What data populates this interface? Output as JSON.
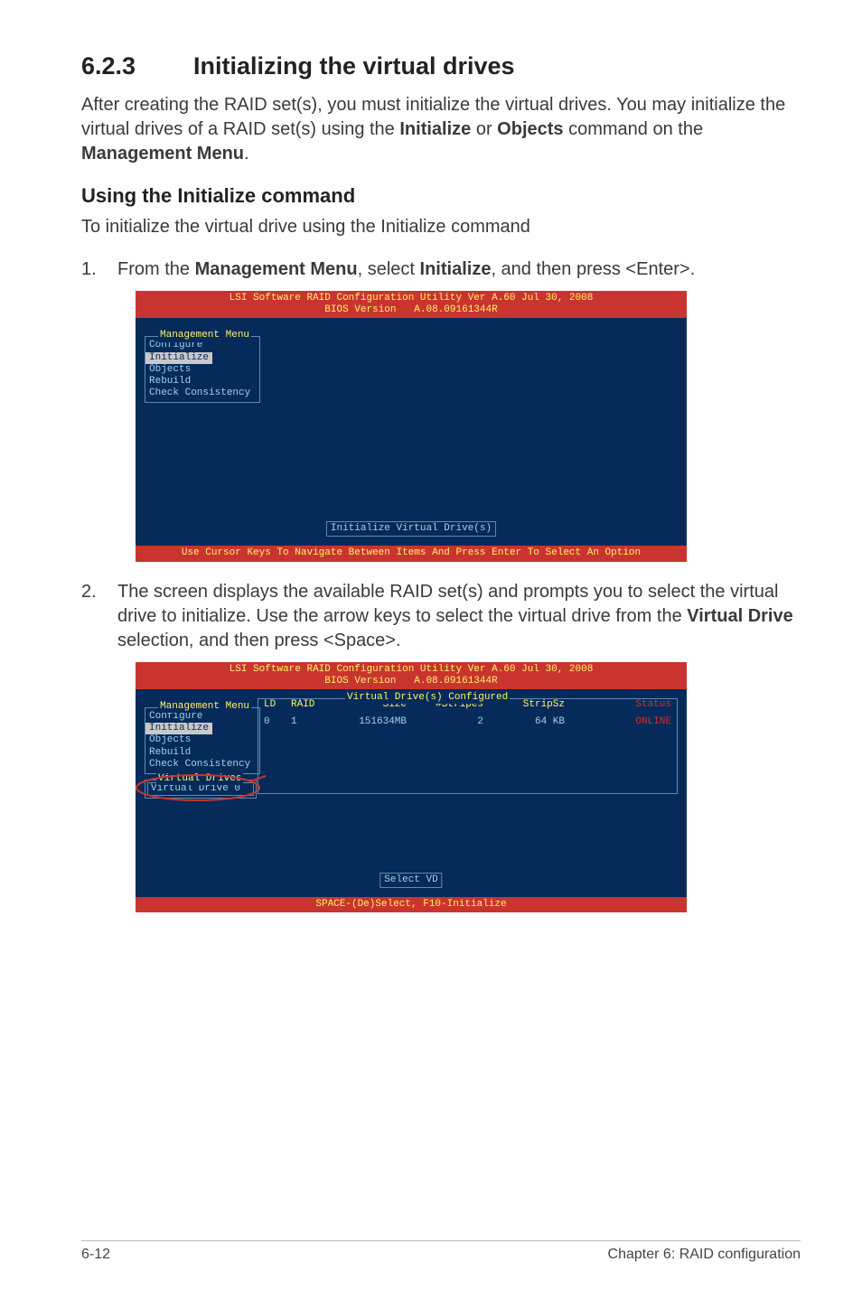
{
  "section": {
    "number": "6.2.3",
    "title": "Initializing the virtual drives"
  },
  "intro": {
    "p1a": "After creating the RAID set(s), you must initialize the virtual drives. You may initialize the virtual drives of a RAID set(s) using the ",
    "b1": "Initialize",
    "p1b": " or ",
    "b2": "Objects",
    "p1c": " command on the ",
    "b3": "Management Menu",
    "p1d": "."
  },
  "sub1": {
    "title": "Using the Initialize command",
    "lead": "To initialize the virtual drive using the Initialize command"
  },
  "step1": {
    "num": "1.",
    "a": "From the ",
    "b1": "Management Menu",
    "b": ", select ",
    "b2": "Initialize",
    "c": ", and then press <Enter>."
  },
  "bios": {
    "title": "LSI Software RAID Configuration Utility Ver A.60 Jul 30, 2008\nBIOS Version   A.08.09161344R",
    "mgmt_title": "Management Menu",
    "items": {
      "configure": "Configure",
      "initialize": "Initialize",
      "objects": "Objects",
      "rebuild": "Rebuild",
      "check": "Check Consistency"
    },
    "status1": "Initialize Virtual Drive(s)",
    "footer1": "Use Cursor Keys To Navigate Between Items And Press Enter To Select An Option"
  },
  "step2": {
    "num": "2.",
    "a": "The screen displays the available RAID set(s) and prompts you to select the virtual drive to initialize. Use the arrow keys to select the virtual drive from the ",
    "b1": "Virtual Drive",
    "b": " selection, and then press <Space>."
  },
  "bios2": {
    "vd_title": "Virtual Drive(s) Configured",
    "head": {
      "ld": "LD",
      "raid": "RAID",
      "size": "Size",
      "stripes": "#Stripes",
      "stripsz": "StripSz",
      "status": "Status"
    },
    "row": {
      "ld": "0",
      "raid": "1",
      "size": "151634MB",
      "stripes": "2",
      "stripsz": "64 KB",
      "status": "ONLINE"
    },
    "vdrives_title": "Virtual Drives",
    "vdrive0": "Virtual Drive 0",
    "status2": "Select VD",
    "footer2": "SPACE-(De)Select,  F10-Initialize"
  },
  "footer": {
    "left": "6-12",
    "right": "Chapter 6: RAID configuration"
  }
}
